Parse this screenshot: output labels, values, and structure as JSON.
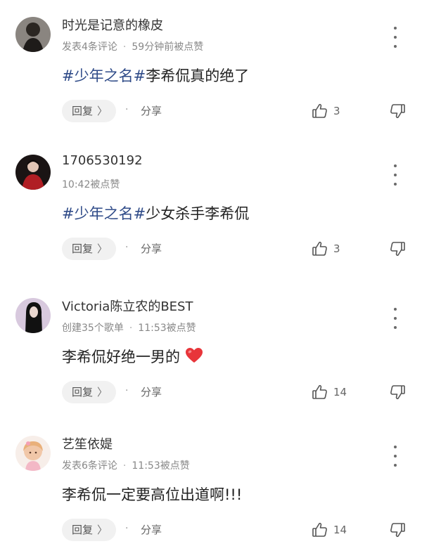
{
  "comments": [
    {
      "username": "时光是记意的橡皮",
      "meta_left": "发表4条评论",
      "meta_right": "59分钟前被点赞",
      "tag": "#少年之名#",
      "text": "李希侃真的绝了",
      "reply_label": "回复",
      "share_label": "分享",
      "likes": "3",
      "avatar_color": "#6b655f"
    },
    {
      "username": "1706530192",
      "meta_left": "",
      "meta_right": "10:42被点赞",
      "tag": "#少年之名#",
      "text": "少女杀手李希侃",
      "reply_label": "回复",
      "share_label": "分享",
      "likes": "3",
      "avatar_color": "#2a1a1a"
    },
    {
      "username": "Victoria陈立农的BEST",
      "meta_left": "创建35个歌单",
      "meta_right": "11:53被点赞",
      "tag": "",
      "text": "李希侃好绝一男的",
      "emoji": "red-heart",
      "reply_label": "回复",
      "share_label": "分享",
      "likes": "14",
      "avatar_color": "#d9c8dc"
    },
    {
      "username": "艺笙依媞",
      "meta_left": "发表6条评论",
      "meta_right": "11:53被点赞",
      "tag": "",
      "text": "李希侃一定要高位出道啊!!!",
      "reply_label": "回复",
      "share_label": "分享",
      "likes": "14",
      "avatar_color": "#f3e4dc"
    }
  ],
  "icons": {
    "more": "more-vertical-icon",
    "like": "thumbs-up-icon",
    "dislike": "thumbs-down-icon",
    "reply_chevron": "chevron-right-icon"
  },
  "colors": {
    "tag": "#2f4b88",
    "heart": "#e8353a",
    "meta": "#888888"
  },
  "glyphs": {
    "chevron": "〉",
    "separator": "·"
  }
}
